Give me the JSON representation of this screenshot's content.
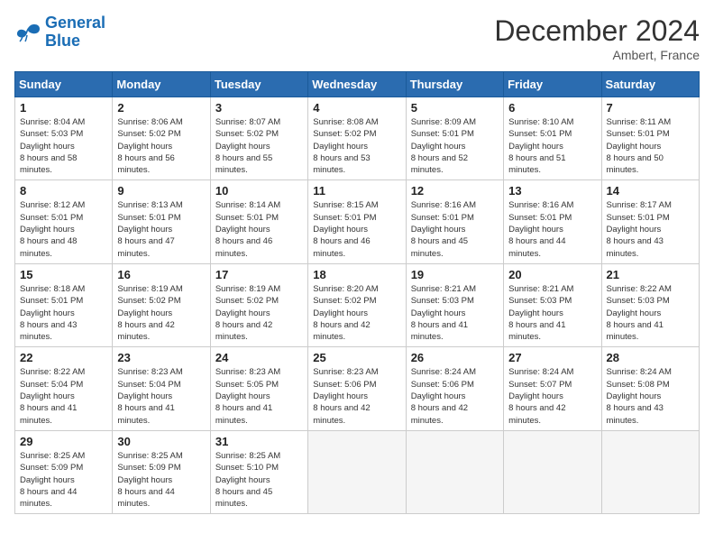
{
  "header": {
    "logo_line1": "General",
    "logo_line2": "Blue",
    "title": "December 2024",
    "subtitle": "Ambert, France"
  },
  "weekdays": [
    "Sunday",
    "Monday",
    "Tuesday",
    "Wednesday",
    "Thursday",
    "Friday",
    "Saturday"
  ],
  "weeks": [
    [
      {
        "day": "1",
        "sunrise": "8:04 AM",
        "sunset": "5:03 PM",
        "daylight": "8 hours and 58 minutes."
      },
      {
        "day": "2",
        "sunrise": "8:06 AM",
        "sunset": "5:02 PM",
        "daylight": "8 hours and 56 minutes."
      },
      {
        "day": "3",
        "sunrise": "8:07 AM",
        "sunset": "5:02 PM",
        "daylight": "8 hours and 55 minutes."
      },
      {
        "day": "4",
        "sunrise": "8:08 AM",
        "sunset": "5:02 PM",
        "daylight": "8 hours and 53 minutes."
      },
      {
        "day": "5",
        "sunrise": "8:09 AM",
        "sunset": "5:01 PM",
        "daylight": "8 hours and 52 minutes."
      },
      {
        "day": "6",
        "sunrise": "8:10 AM",
        "sunset": "5:01 PM",
        "daylight": "8 hours and 51 minutes."
      },
      {
        "day": "7",
        "sunrise": "8:11 AM",
        "sunset": "5:01 PM",
        "daylight": "8 hours and 50 minutes."
      }
    ],
    [
      {
        "day": "8",
        "sunrise": "8:12 AM",
        "sunset": "5:01 PM",
        "daylight": "8 hours and 48 minutes."
      },
      {
        "day": "9",
        "sunrise": "8:13 AM",
        "sunset": "5:01 PM",
        "daylight": "8 hours and 47 minutes."
      },
      {
        "day": "10",
        "sunrise": "8:14 AM",
        "sunset": "5:01 PM",
        "daylight": "8 hours and 46 minutes."
      },
      {
        "day": "11",
        "sunrise": "8:15 AM",
        "sunset": "5:01 PM",
        "daylight": "8 hours and 46 minutes."
      },
      {
        "day": "12",
        "sunrise": "8:16 AM",
        "sunset": "5:01 PM",
        "daylight": "8 hours and 45 minutes."
      },
      {
        "day": "13",
        "sunrise": "8:16 AM",
        "sunset": "5:01 PM",
        "daylight": "8 hours and 44 minutes."
      },
      {
        "day": "14",
        "sunrise": "8:17 AM",
        "sunset": "5:01 PM",
        "daylight": "8 hours and 43 minutes."
      }
    ],
    [
      {
        "day": "15",
        "sunrise": "8:18 AM",
        "sunset": "5:01 PM",
        "daylight": "8 hours and 43 minutes."
      },
      {
        "day": "16",
        "sunrise": "8:19 AM",
        "sunset": "5:02 PM",
        "daylight": "8 hours and 42 minutes."
      },
      {
        "day": "17",
        "sunrise": "8:19 AM",
        "sunset": "5:02 PM",
        "daylight": "8 hours and 42 minutes."
      },
      {
        "day": "18",
        "sunrise": "8:20 AM",
        "sunset": "5:02 PM",
        "daylight": "8 hours and 42 minutes."
      },
      {
        "day": "19",
        "sunrise": "8:21 AM",
        "sunset": "5:03 PM",
        "daylight": "8 hours and 41 minutes."
      },
      {
        "day": "20",
        "sunrise": "8:21 AM",
        "sunset": "5:03 PM",
        "daylight": "8 hours and 41 minutes."
      },
      {
        "day": "21",
        "sunrise": "8:22 AM",
        "sunset": "5:03 PM",
        "daylight": "8 hours and 41 minutes."
      }
    ],
    [
      {
        "day": "22",
        "sunrise": "8:22 AM",
        "sunset": "5:04 PM",
        "daylight": "8 hours and 41 minutes."
      },
      {
        "day": "23",
        "sunrise": "8:23 AM",
        "sunset": "5:04 PM",
        "daylight": "8 hours and 41 minutes."
      },
      {
        "day": "24",
        "sunrise": "8:23 AM",
        "sunset": "5:05 PM",
        "daylight": "8 hours and 41 minutes."
      },
      {
        "day": "25",
        "sunrise": "8:23 AM",
        "sunset": "5:06 PM",
        "daylight": "8 hours and 42 minutes."
      },
      {
        "day": "26",
        "sunrise": "8:24 AM",
        "sunset": "5:06 PM",
        "daylight": "8 hours and 42 minutes."
      },
      {
        "day": "27",
        "sunrise": "8:24 AM",
        "sunset": "5:07 PM",
        "daylight": "8 hours and 42 minutes."
      },
      {
        "day": "28",
        "sunrise": "8:24 AM",
        "sunset": "5:08 PM",
        "daylight": "8 hours and 43 minutes."
      }
    ],
    [
      {
        "day": "29",
        "sunrise": "8:25 AM",
        "sunset": "5:09 PM",
        "daylight": "8 hours and 44 minutes."
      },
      {
        "day": "30",
        "sunrise": "8:25 AM",
        "sunset": "5:09 PM",
        "daylight": "8 hours and 44 minutes."
      },
      {
        "day": "31",
        "sunrise": "8:25 AM",
        "sunset": "5:10 PM",
        "daylight": "8 hours and 45 minutes."
      },
      null,
      null,
      null,
      null
    ]
  ]
}
